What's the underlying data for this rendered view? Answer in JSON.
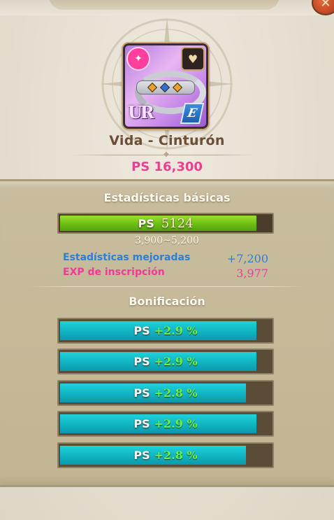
{
  "item": {
    "name": "Vida - Cinturón",
    "total_stat": "PS 16,300",
    "rarity": "UR",
    "grade": "E"
  },
  "basic_stats": {
    "title": "Estadísticas básicas",
    "stat_label": "PS",
    "value": "5124",
    "fill_fraction": 0.93,
    "range": "3,900~5,200",
    "improved_label": "Estadísticas mejoradas",
    "improved_value": "+7,200",
    "inscription_label": "EXP de inscripción",
    "inscription_value": "3,977"
  },
  "bonus": {
    "title": "Bonificación",
    "rows": [
      {
        "stat": "PS",
        "value": "+2.9 %",
        "fill_fraction": 0.93
      },
      {
        "stat": "PS",
        "value": "+2.9 %",
        "fill_fraction": 0.93
      },
      {
        "stat": "PS",
        "value": "+2.8 %",
        "fill_fraction": 0.88
      },
      {
        "stat": "PS",
        "value": "+2.9 %",
        "fill_fraction": 0.93
      },
      {
        "stat": "PS",
        "value": "+2.8 %",
        "fill_fraction": 0.88
      }
    ]
  },
  "icons": {
    "close": "close-icon",
    "element": "element-crest-icon",
    "type": "heart-icon",
    "item": "belt-icon"
  },
  "colors": {
    "total_stat": "#ec3e92",
    "improved": "#2b7fd6",
    "inscription": "#f0399a",
    "main_bar": "#6cbf13",
    "bonus_bar": "#11b3c2",
    "bonus_value": "#6df048"
  }
}
